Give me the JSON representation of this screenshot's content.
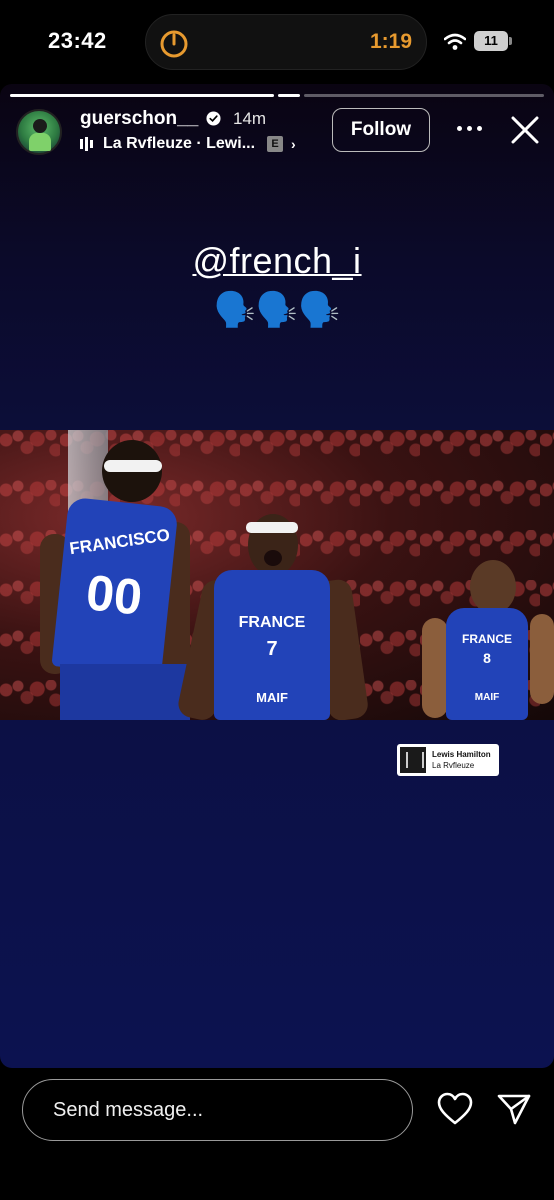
{
  "status_bar": {
    "time": "23:42",
    "timer": "1:19",
    "battery": "11"
  },
  "story": {
    "username": "guerschon__",
    "age": "14m",
    "music": "La Rvfleuze · Lewi...",
    "explicit": "E",
    "follow_label": "Follow",
    "mention": "@french_i",
    "emojis": "🗣️🗣️🗣️",
    "photo": {
      "left_player_name": "FRANCISCO",
      "left_player_number": "00",
      "center_jersey": "FRANCE",
      "center_number": "7",
      "center_sponsor": "MAIF",
      "right_jersey": "FRANCE",
      "right_number": "8",
      "right_sponsor": "MAIF"
    },
    "sticker": {
      "title": "Lewis Hamilton",
      "artist": "La Rvfleuze"
    }
  },
  "bottom_bar": {
    "send_placeholder": "Send message..."
  },
  "colors": {
    "timer_accent": "#e79a2f",
    "jersey_blue": "#2243b8"
  }
}
